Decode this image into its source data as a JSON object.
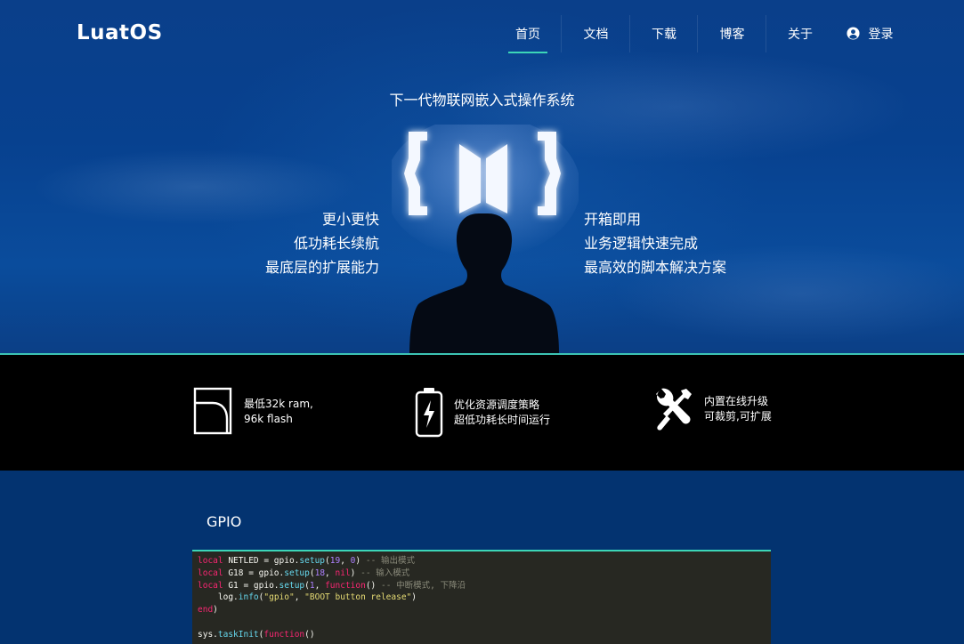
{
  "app": {
    "logo": "LuatOS"
  },
  "nav": {
    "items": [
      {
        "label": "首页",
        "active": true
      },
      {
        "label": "文档",
        "active": false
      },
      {
        "label": "下载",
        "active": false
      },
      {
        "label": "博客",
        "active": false
      },
      {
        "label": "关于",
        "active": false
      }
    ],
    "login": {
      "label": "登录",
      "icon": "user-circle-icon"
    }
  },
  "hero": {
    "subtitle": "下一代物联网嵌入式操作系统",
    "features_left": [
      "更小更快",
      "低功耗长续航",
      "最底层的扩展能力"
    ],
    "features_right": [
      "开箱即用",
      "业务逻辑快速完成",
      "最高效的脚本解决方案"
    ]
  },
  "band": {
    "items": [
      {
        "icon": "memory-chip-icon",
        "line1": "最低32k ram,",
        "line2": "96k flash"
      },
      {
        "icon": "battery-charging-icon",
        "line1": "优化资源调度策略",
        "line2": "超低功耗长时间运行"
      },
      {
        "icon": "tools-icon",
        "line1": "内置在线升级",
        "line2": "可裁剪,可扩展"
      }
    ]
  },
  "code": {
    "title": "GPIO",
    "lines": [
      "local NETLED = gpio.setup(19, 0) -- 输出模式",
      "local G18 = gpio.setup(18, nil) -- 输入模式",
      "local G1 = gpio.setup(1, function() -- 中断模式, 下降沿",
      "    log.info(\"gpio\", \"BOOT button release\")",
      "end)",
      "",
      "sys.taskInit(function()"
    ]
  },
  "colors": {
    "accent": "#3cd6b7",
    "hero_blue": "#0a4c9c",
    "band_bg": "#000000",
    "section_bg": "#033370",
    "code_bg": "#272822"
  }
}
